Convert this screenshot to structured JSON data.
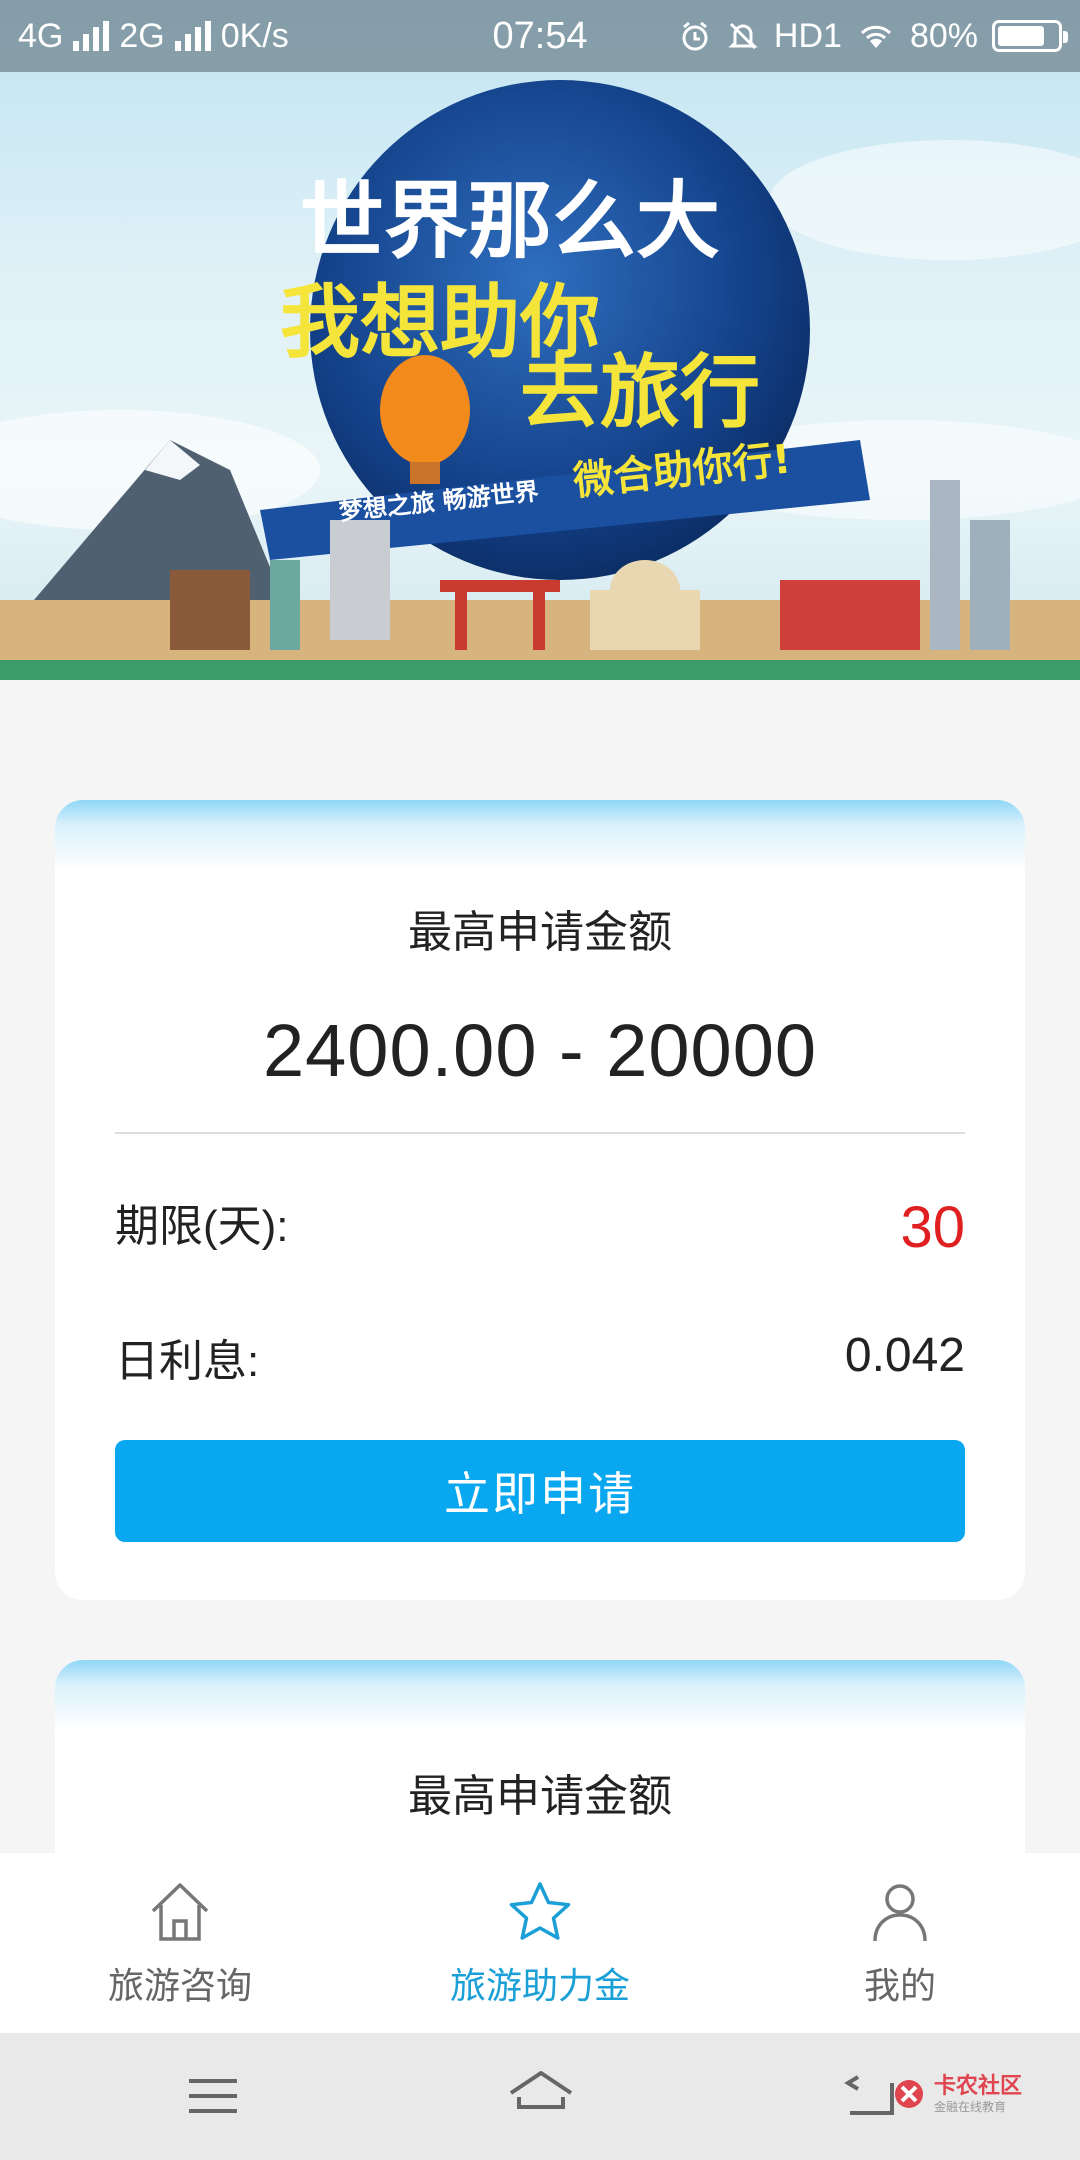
{
  "status_bar": {
    "network1": "4G",
    "network2": "2G",
    "speed": "0K/s",
    "time": "07:54",
    "hd": "HD1",
    "battery": "80%",
    "battery_level": 0.8
  },
  "banner": {
    "headline1": "世界那么大",
    "headline2a": "我想助你",
    "headline2b": "去旅行",
    "ribbon_left": "梦想之旅 畅游世界",
    "ribbon_right": "微合助你行!"
  },
  "cards": [
    {
      "title": "最高申请金额",
      "range": "2400.00 - 20000",
      "term_label": "期限(天):",
      "term_value": "30",
      "interest_label": "日利息:",
      "interest_value": "0.042",
      "apply_label": "立即申请"
    },
    {
      "title": "最高申请金额"
    }
  ],
  "tabbar": {
    "items": [
      {
        "label": "旅游咨询",
        "icon": "home-icon",
        "active": false
      },
      {
        "label": "旅游助力金",
        "icon": "star-icon",
        "active": true
      },
      {
        "label": "我的",
        "icon": "user-icon",
        "active": false
      }
    ]
  },
  "navbar": {
    "watermark_main": "卡农社区",
    "watermark_sub": "金融在线教育"
  },
  "colors": {
    "accent": "#08a7ef",
    "active_tab": "#1a9fd6",
    "term_value": "#e02020"
  }
}
